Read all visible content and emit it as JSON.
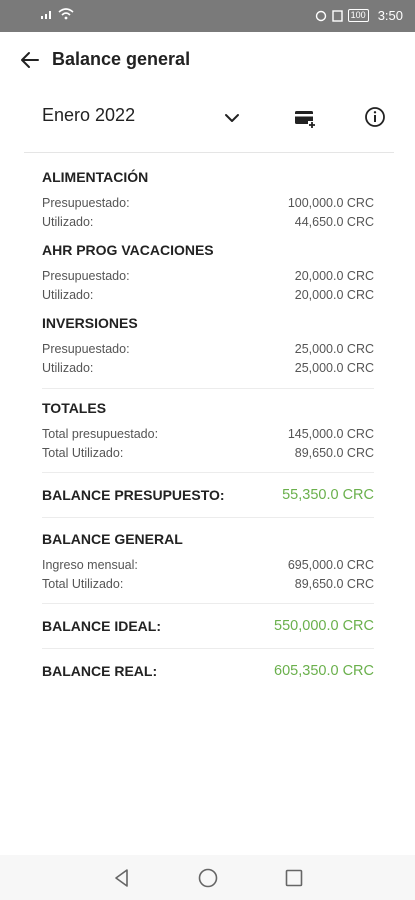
{
  "status": {
    "time": "3:50",
    "battery": "100"
  },
  "header": {
    "title": "Balance general"
  },
  "selector": {
    "month": "Enero 2022"
  },
  "sections": [
    {
      "title": "ALIMENTACIÓN",
      "rows": [
        {
          "label": "Presupuestado:",
          "value": "100,000.0 CRC"
        },
        {
          "label": "Utilizado:",
          "value": "44,650.0 CRC"
        }
      ]
    },
    {
      "title": "AHR PROG VACACIONES",
      "rows": [
        {
          "label": "Presupuestado:",
          "value": "20,000.0 CRC"
        },
        {
          "label": "Utilizado:",
          "value": "20,000.0 CRC"
        }
      ]
    },
    {
      "title": "INVERSIONES",
      "rows": [
        {
          "label": "Presupuestado:",
          "value": "25,000.0 CRC"
        },
        {
          "label": "Utilizado:",
          "value": "25,000.0 CRC"
        }
      ]
    }
  ],
  "totales": {
    "title": "TOTALES",
    "rows": [
      {
        "label": "Total presupuestado:",
        "value": "145,000.0 CRC"
      },
      {
        "label": "Total Utilizado:",
        "value": "89,650.0 CRC"
      }
    ],
    "balance_label": "BALANCE PRESUPUESTO:",
    "balance_value": "55,350.0 CRC"
  },
  "general": {
    "title": "BALANCE GENERAL",
    "rows": [
      {
        "label": "Ingreso mensual:",
        "value": "695,000.0 CRC"
      },
      {
        "label": "Total Utilizado:",
        "value": "89,650.0 CRC"
      }
    ],
    "ideal_label": "BALANCE IDEAL:",
    "ideal_value": "550,000.0 CRC",
    "real_label": "BALANCE REAL:",
    "real_value": "605,350.0 CRC"
  },
  "colors": {
    "positive": "#6ab04c",
    "statusbar": "#7a7a7a"
  },
  "icons": [
    "back-arrow-icon",
    "chevron-down-icon",
    "card-add-icon",
    "info-icon",
    "nav-back-icon",
    "nav-home-icon",
    "nav-recents-icon"
  ]
}
